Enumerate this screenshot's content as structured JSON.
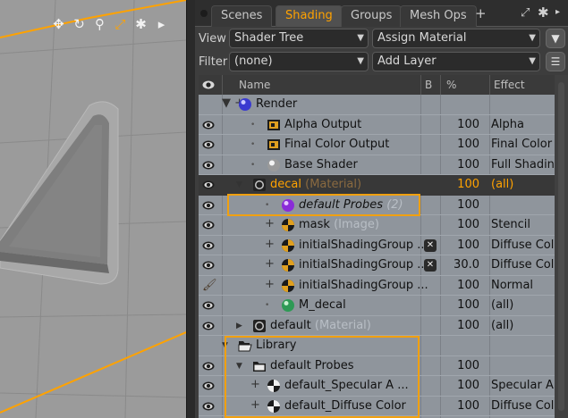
{
  "viewport": {
    "tools": [
      {
        "name": "move-icon",
        "glyph": "✥"
      },
      {
        "name": "rotate-icon",
        "glyph": "↻"
      },
      {
        "name": "zoom-icon",
        "glyph": "⚲"
      },
      {
        "name": "scale-icon",
        "glyph": "⤢"
      },
      {
        "name": "gear-icon",
        "glyph": "✱"
      },
      {
        "name": "more-arrow-icon",
        "glyph": "▸"
      }
    ],
    "accent": "#ffa200"
  },
  "tabs": [
    {
      "label": "Scenes",
      "active": false
    },
    {
      "label": "Shading",
      "active": true
    },
    {
      "label": "Groups",
      "active": false
    },
    {
      "label": "Mesh Ops",
      "active": false
    }
  ],
  "tab_add": "+",
  "view": {
    "label": "View",
    "value": "Shader Tree",
    "action": "Assign Material"
  },
  "filter": {
    "label": "Filter",
    "value": "(none)",
    "action": "Add Layer"
  },
  "columns": {
    "name": "Name",
    "b": "B",
    "pct": "%",
    "effect": "Effect"
  },
  "rows": [
    {
      "name": "Render",
      "sub": "",
      "pct": "",
      "effect": "",
      "icon": "sphere-blue",
      "indent": 0,
      "exp": "tri+",
      "eye": false
    },
    {
      "name": "Alpha Output",
      "sub": "",
      "pct": "100",
      "effect": "Alpha",
      "icon": "output",
      "indent": 2,
      "exp": "dot",
      "eye": true
    },
    {
      "name": "Final Color Output",
      "sub": "",
      "pct": "100",
      "effect": "Final Color",
      "icon": "output",
      "indent": 2,
      "exp": "dot",
      "eye": true
    },
    {
      "name": "Base Shader",
      "sub": "",
      "pct": "100",
      "effect": "Full Shading",
      "icon": "sphere-white",
      "indent": 2,
      "exp": "dot",
      "eye": true
    },
    {
      "name": "decal",
      "sub": "(Material)",
      "pct": "100",
      "effect": "(all)",
      "icon": "material",
      "indent": 1,
      "exp": "tri",
      "eye": true,
      "selected": true
    },
    {
      "name": "default Probes",
      "sub": "(2)",
      "pct": "100",
      "effect": "",
      "icon": "sphere-purple",
      "indent": 3,
      "exp": "dot",
      "eye": true,
      "italic": true
    },
    {
      "name": "mask",
      "sub": "(Image)",
      "pct": "100",
      "effect": "Stencil",
      "icon": "image",
      "indent": 3,
      "exp": "plus",
      "eye": true
    },
    {
      "name": "initialShadingGroup ...",
      "sub": "",
      "pct": "100",
      "effect": "Diffuse Color",
      "icon": "image",
      "indent": 3,
      "exp": "plus",
      "eye": true,
      "x": true
    },
    {
      "name": "initialShadingGroup ...",
      "sub": "",
      "pct": "30.0",
      "effect": "Diffuse Color",
      "icon": "image",
      "indent": 3,
      "exp": "plus",
      "eye": true,
      "x": true
    },
    {
      "name": "initialShadingGroup ...",
      "sub": "",
      "pct": "100",
      "effect": "Normal",
      "icon": "image",
      "indent": 3,
      "exp": "plus",
      "eye": false,
      "brush": true
    },
    {
      "name": "M_decal",
      "sub": "",
      "pct": "100",
      "effect": "(all)",
      "icon": "sphere-green",
      "indent": 3,
      "exp": "dot",
      "eye": true
    },
    {
      "name": "default",
      "sub": "(Material)",
      "pct": "100",
      "effect": "(all)",
      "icon": "material",
      "indent": 1,
      "exp": "tri-right",
      "eye": true
    },
    {
      "name": "Library",
      "sub": "",
      "pct": "",
      "effect": "",
      "icon": "folder-open",
      "indent": 0,
      "exp": "tri",
      "eye": false
    },
    {
      "name": "default Probes",
      "sub": "",
      "pct": "100",
      "effect": "",
      "icon": "folder",
      "indent": 1,
      "exp": "tri",
      "eye": true
    },
    {
      "name": "default_Specular A ...",
      "sub": "",
      "pct": "100",
      "effect": "Specular Amount",
      "icon": "checker",
      "indent": 2,
      "exp": "plus",
      "eye": true
    },
    {
      "name": "default_Diffuse Color",
      "sub": "",
      "pct": "100",
      "effect": "Diffuse Color",
      "icon": "checker",
      "indent": 2,
      "exp": "plus",
      "eye": true
    }
  ]
}
